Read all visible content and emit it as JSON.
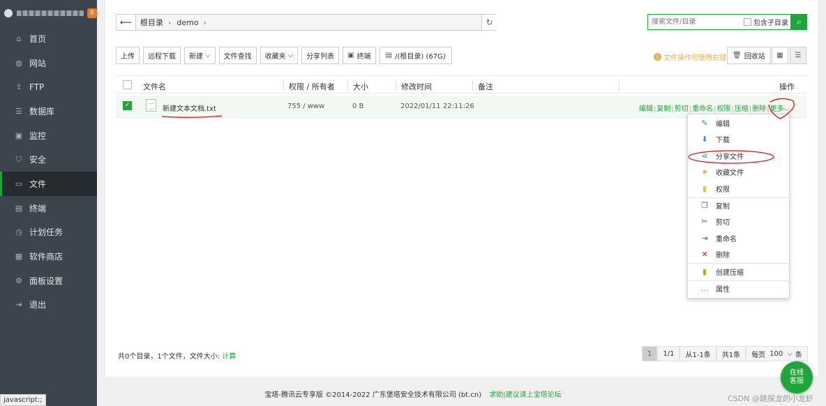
{
  "sidebar": {
    "badge": "8",
    "items": [
      {
        "label": "首页",
        "icon": "home-icon",
        "glyph": "⌂"
      },
      {
        "label": "网站",
        "icon": "globe-icon",
        "glyph": "◍"
      },
      {
        "label": "FTP",
        "icon": "ftp-icon",
        "glyph": "⇪"
      },
      {
        "label": "数据库",
        "icon": "database-icon",
        "glyph": "☰"
      },
      {
        "label": "监控",
        "icon": "monitor-icon",
        "glyph": "▣"
      },
      {
        "label": "安全",
        "icon": "shield-icon",
        "glyph": "⛉"
      },
      {
        "label": "文件",
        "icon": "folder-icon",
        "glyph": "▭"
      },
      {
        "label": "终端",
        "icon": "terminal-icon",
        "glyph": "▤"
      },
      {
        "label": "计划任务",
        "icon": "clock-icon",
        "glyph": "◷"
      },
      {
        "label": "软件商店",
        "icon": "apps-icon",
        "glyph": "▦"
      },
      {
        "label": "面板设置",
        "icon": "gear-icon",
        "glyph": "⚙"
      },
      {
        "label": "退出",
        "icon": "logout-icon",
        "glyph": "⇥"
      }
    ],
    "active_index": 6
  },
  "path": {
    "root": "根目录",
    "dir": "demo"
  },
  "search": {
    "placeholder": "搜索文件/目录",
    "include_sub": "包含子目录"
  },
  "toolbar": {
    "upload": "上传",
    "remote_download": "远程下载",
    "new": "新建",
    "find": "文件查找",
    "favorites": "收藏夹",
    "share_list": "分享列表",
    "terminal": "终端",
    "disk": "/(根目录) (67G)",
    "tip": "文件操作可使用右键",
    "recycle": "回收站"
  },
  "table": {
    "headers": {
      "name": "文件名",
      "perm": "权限 / 所有者",
      "size": "大小",
      "mtime": "修改时间",
      "note": "备注",
      "ops": "操作"
    },
    "rows": [
      {
        "name": "新建文本文档.txt",
        "perm": "755 / www",
        "size": "0 B",
        "mtime": "2022/01/11 22:11:26",
        "note": ""
      }
    ],
    "ops": [
      "编辑",
      "复制",
      "剪切",
      "重命名",
      "权限",
      "压缩",
      "删除"
    ],
    "more": "更多"
  },
  "menu": [
    {
      "label": "编辑",
      "icon": "edit-icon"
    },
    {
      "label": "下载",
      "icon": "download-icon"
    },
    {
      "label": "分享文件",
      "icon": "share-icon"
    },
    {
      "label": "收藏文件",
      "icon": "star-icon"
    },
    {
      "label": "权限",
      "icon": "permission-icon"
    },
    {
      "label": "复制",
      "icon": "copy-icon"
    },
    {
      "label": "剪切",
      "icon": "scissors-icon"
    },
    {
      "label": "重命名",
      "icon": "rename-icon"
    },
    {
      "label": "删除",
      "icon": "delete-icon"
    },
    {
      "label": "创建压缩",
      "icon": "archive-icon"
    },
    {
      "label": "属性",
      "icon": "properties-icon"
    }
  ],
  "footer": {
    "summary": "共0个目录，1个文件，文件大小:",
    "calc": "计算",
    "pager": {
      "current": "1",
      "total_pages": "1/1",
      "range": "从1-1条",
      "count": "共1条",
      "per_page_label": "每页",
      "per_page": "100",
      "unit": "条"
    }
  },
  "copyright": {
    "text": "宝塔-腾讯云专享版 ©2014-2022 广东堡塔安全技术有限公司 (bt.cn)",
    "link": "求助|建议请上宝塔论坛"
  },
  "status_url": "javascript:;",
  "kefu": {
    "line1": "在线",
    "line2": "客服"
  },
  "watermark": "CSDN @跳探龙的小龙虾",
  "colors": {
    "accent": "#20a53a",
    "sidebar_bg": "#3c444d",
    "annotation": "#e0101a"
  }
}
